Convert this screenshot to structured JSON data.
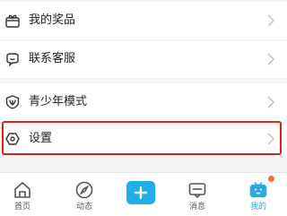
{
  "menu": {
    "items": [
      {
        "label": "我的奖品",
        "icon": "gift-icon"
      },
      {
        "label": "联系客服",
        "icon": "chat-icon"
      },
      {
        "label": "青少年模式",
        "icon": "youth-shield-icon"
      },
      {
        "label": "设置",
        "icon": "settings-hexagon-icon"
      }
    ]
  },
  "tabbar": {
    "tabs": [
      {
        "label": "首页",
        "icon": "home-icon"
      },
      {
        "label": "动态",
        "icon": "compass-icon"
      },
      {
        "label": "",
        "icon": "plus-icon"
      },
      {
        "label": "消息",
        "icon": "message-icon"
      },
      {
        "label": "我的",
        "icon": "bilibili-tv-icon",
        "active": true
      }
    ]
  },
  "colors": {
    "accent": "#2aa9e0",
    "plus_button": "#1eaeea",
    "highlight_border": "#e0201b",
    "notification_dot": "#ff6a3c"
  }
}
